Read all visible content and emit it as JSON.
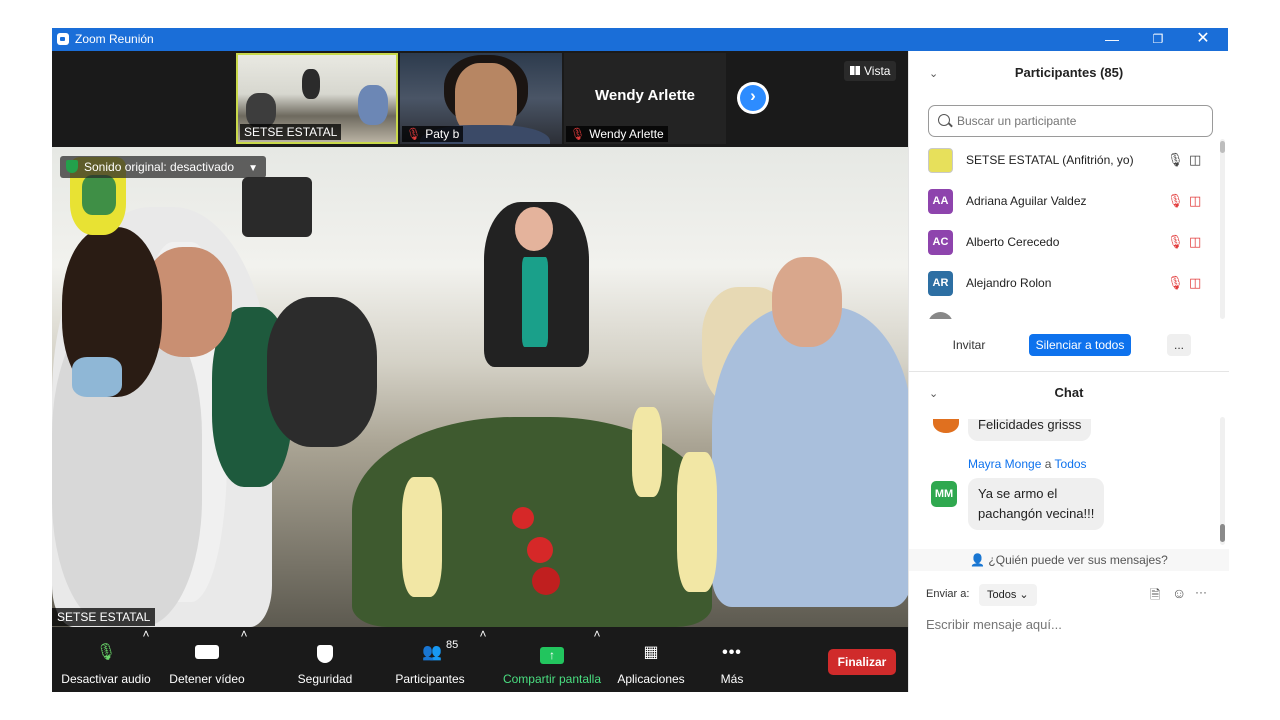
{
  "window": {
    "title": "Zoom Reunión",
    "controls": [
      "minimize-icon",
      "restore-icon",
      "close-icon"
    ]
  },
  "strip": {
    "thumbs": [
      {
        "name": "SETSE ESTATAL",
        "muted": false
      },
      {
        "name": "Paty b",
        "muted": true
      },
      {
        "name": "Wendy  Arlette",
        "muted": true,
        "big": "Wendy  Arlette"
      }
    ],
    "view_label": "Vista"
  },
  "main_video": {
    "notice": "Sonido original: desactivado",
    "name": "SETSE ESTATAL"
  },
  "toolbar": {
    "mute": "Desactivar audio",
    "video": "Detener vídeo",
    "security": "Seguridad",
    "participants": "Participantes",
    "participants_count": "85",
    "share": "Compartir pantalla",
    "apps": "Aplicaciones",
    "more": "Más",
    "end": "Finalizar"
  },
  "participants_panel": {
    "title": "Participantes (85)",
    "search_placeholder": "Buscar un participante",
    "list": [
      {
        "initials": "",
        "name": "SETSE ESTATAL (Anfitrión, yo)",
        "color": "#c9d94a",
        "muted": false
      },
      {
        "initials": "AA",
        "name": "Adriana Aguilar Valdez",
        "color": "#8e44ad",
        "muted": true
      },
      {
        "initials": "AC",
        "name": "Alberto Cerecedo",
        "color": "#8e44ad",
        "muted": true
      },
      {
        "initials": "AR",
        "name": "Alejandro Rolon",
        "color": "#2d6fa3",
        "muted": true
      }
    ],
    "invite": "Invitar",
    "mute_all": "Silenciar a todos",
    "more": "..."
  },
  "chat": {
    "title": "Chat",
    "messages": [
      {
        "text": "Felicidades grisss"
      },
      {
        "sender": "Mayra Monge",
        "to_word": "a",
        "to": "Todos",
        "initials": "MM",
        "line1": "Ya se armo el",
        "line2": "pachangón vecina!!!"
      }
    ],
    "who_can_see": "¿Quién puede ver sus mensajes?",
    "send_to_label": "Enviar a:",
    "send_to_value": "Todos",
    "input_placeholder": "Escribir mensaje aquí..."
  },
  "colors": {
    "titlebar": "#1a6ed8",
    "end_button": "#d02b2b",
    "accent": "#0e72ed",
    "share": "#22c55e"
  }
}
